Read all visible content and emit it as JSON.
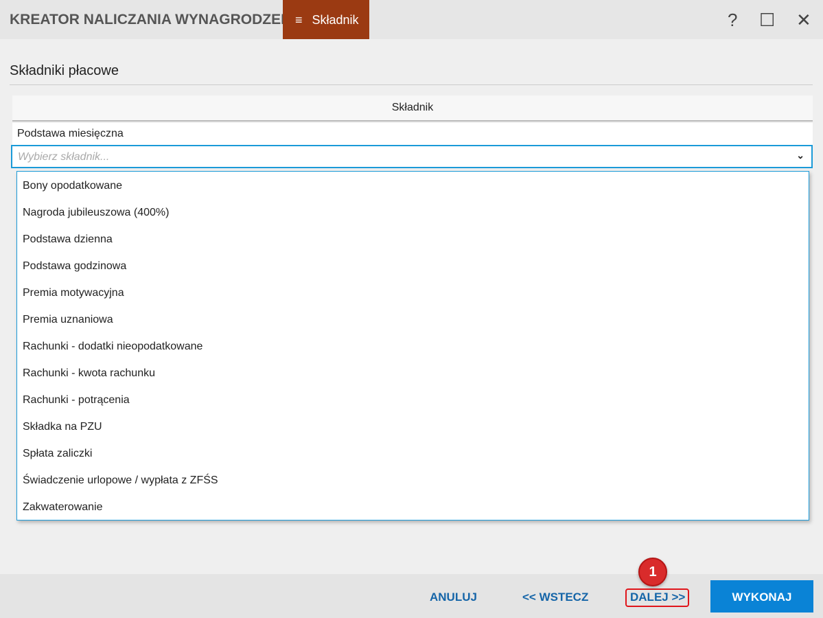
{
  "window": {
    "title": "KREATOR NALICZANIA WYNAGRODZEŃ",
    "tab_label": "Składnik",
    "tab_icon": "≡",
    "help": "?",
    "maximize": "☐",
    "close": "✕"
  },
  "section": {
    "title": "Składniki płacowe",
    "column": "Składnik",
    "row_value": "Podstawa miesięczna",
    "combo_placeholder": "Wybierz składnik..."
  },
  "dropdown": {
    "items": [
      "Bony opodatkowane",
      "Nagroda jubileuszowa (400%)",
      "Podstawa dzienna",
      "Podstawa godzinowa",
      "Premia motywacyjna",
      "Premia uznaniowa",
      "Rachunki - dodatki nieopodatkowane",
      "Rachunki - kwota rachunku",
      "Rachunki - potrącenia",
      "Składka na PZU",
      "Spłata zaliczki",
      "Świadczenie urlopowe / wypłata z ZFŚS",
      "Zakwaterowanie"
    ]
  },
  "footer": {
    "cancel": "ANULUJ",
    "back": "<< WSTECZ",
    "next": "DALEJ >>",
    "execute": "WYKONAJ"
  },
  "annotation": {
    "badge": "1"
  }
}
